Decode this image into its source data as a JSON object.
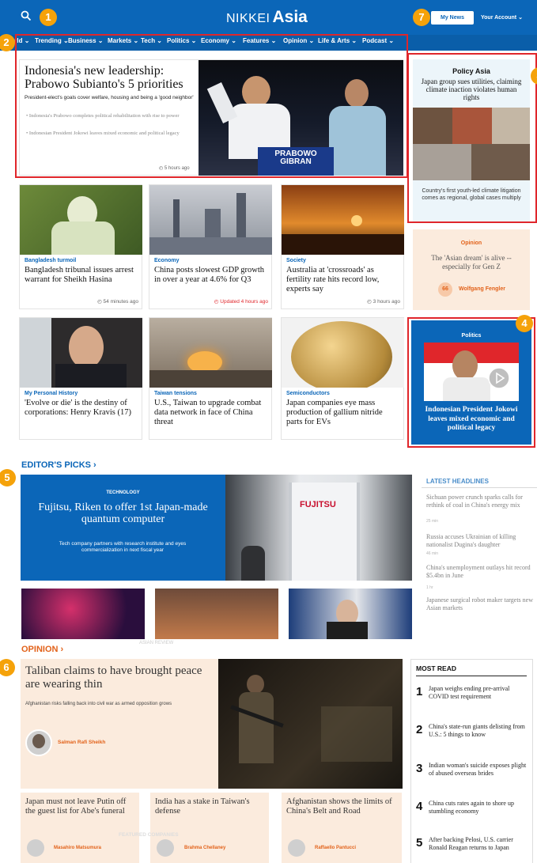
{
  "header": {
    "brand_prefix": "NIKKEI",
    "brand_name": "Asia",
    "my_news": "My News",
    "your_account": "Your Account"
  },
  "nav": {
    "items": [
      "World",
      "Trending",
      "Business",
      "Markets",
      "Tech",
      "Politics",
      "Economy",
      "Features",
      "Opinion",
      "Life & Arts",
      "Podcast"
    ]
  },
  "markers": [
    "1",
    "2",
    "3",
    "4",
    "5",
    "6",
    "7"
  ],
  "lead": {
    "title": "Indonesia's new leadership: Prabowo Subianto's 5 priorities",
    "summary": "President-elect's goals cover welfare, housing and being a 'good neighbor'",
    "bullets": [
      "Indonesia's Prabowo completes political rehabilitation with rise to power",
      "Indonesian President Jokowi leaves mixed economic and political legacy"
    ],
    "time": "5 hours ago",
    "sign_line1": "PRABOWO",
    "sign_line2": "GIBRAN"
  },
  "policy": {
    "label": "Policy Asia",
    "headline": "Japan group sues utilities, claiming climate inaction violates human rights",
    "caption": "Country's first youth-led climate litigation comes as regional, global cases multiply"
  },
  "grid1": [
    {
      "kicker": "Bangladesh turmoil",
      "headline": "Bangladesh tribunal issues arrest warrant for Sheikh Hasina",
      "time": "54 minutes ago"
    },
    {
      "kicker": "Economy",
      "headline": "China posts slowest GDP growth in over a year at 4.6% for Q3",
      "time": "Updated 4 hours ago"
    },
    {
      "kicker": "Society",
      "headline": "Australia at 'crossroads' as fertility rate hits record low, experts say",
      "time": "3 hours ago"
    }
  ],
  "opinion_card": {
    "label": "Opinion",
    "headline": "The 'Asian dream' is alive -- especially for Gen Z",
    "author": "Wolfgang Fengler",
    "quote_mark": "66"
  },
  "grid2": [
    {
      "kicker": "My Personal History",
      "headline": "'Evolve or die' is the destiny of corporations: Henry Kravis (17)"
    },
    {
      "kicker": "Taiwan tensions",
      "headline": "U.S., Taiwan to upgrade combat data network in face of China threat"
    },
    {
      "kicker": "Semiconductors",
      "headline": "Japan companies eye mass production of gallium nitride parts for EVs"
    }
  ],
  "video": {
    "label": "Politics",
    "headline": "Indonesian President Jokowi leaves mixed economic and political legacy"
  },
  "editors_picks": {
    "title": "EDITOR'S PICKS",
    "chevron": "›",
    "tag": "TECHNOLOGY",
    "headline": "Fujitsu, Riken to offer 1st Japan-made quantum computer",
    "subhead": "Tech company partners with research institute and eyes commercialization in next fiscal year",
    "fujitsu_logo": "FUJITSU"
  },
  "latest": {
    "title": "LATEST HEADLINES",
    "items": [
      {
        "text": "Sichuan power crunch sparks calls for rethink of coal in China's energy mix",
        "time": "25 min"
      },
      {
        "text": "Russia accuses Ukrainian of killing nationalist Dugina's daughter",
        "time": "46 min"
      },
      {
        "text": "China's unemployment outlays hit record $5.4bn in June",
        "time": "1 hr"
      },
      {
        "text": "Japanese surgical robot maker targets new Asian markets",
        "time": ""
      }
    ]
  },
  "opinion": {
    "title": "OPINION",
    "chevron": "›",
    "lead_headline": "Taliban claims to have brought peace are wearing thin",
    "lead_summary": "Afghanistan risks falling back into civil war as armed opposition grows",
    "lead_author": "Salman Rafi Sheikh",
    "cards": [
      {
        "headline": "Japan must not leave Putin off the guest list for Abe's funeral",
        "author": "Masahiro Matsumura"
      },
      {
        "headline": "India has a stake in Taiwan's defense",
        "author": "Brahma Chellaney"
      },
      {
        "headline": "Afghanistan shows the limits of China's Belt and Road",
        "author": "Raffaello Pantucci"
      }
    ]
  },
  "most_read": {
    "title": "MOST READ",
    "items": [
      {
        "num": "1",
        "text": "Japan weighs ending pre-arrival COVID test requirement"
      },
      {
        "num": "2",
        "text": "China's state-run giants delisting from U.S.: 5 things to know"
      },
      {
        "num": "3",
        "text": "Indian woman's suicide exposes plight of abused overseas brides"
      },
      {
        "num": "4",
        "text": "China cuts rates again to shore up stumbling economy"
      },
      {
        "num": "5",
        "text": "After backing Pelosi, U.S. carrier Ronald Reagan returns to Japan"
      }
    ]
  },
  "ghost": {
    "featured_companies": "FEATURED COMPANIES",
    "asian_review": "ASIAN REVIEW"
  },
  "colors": {
    "brand_blue": "#0b66b8",
    "highlight_red": "#e0262b",
    "marker_orange": "#f5a20a",
    "opinion_orange": "#e2621a",
    "opinion_bg": "#fbebdd"
  }
}
